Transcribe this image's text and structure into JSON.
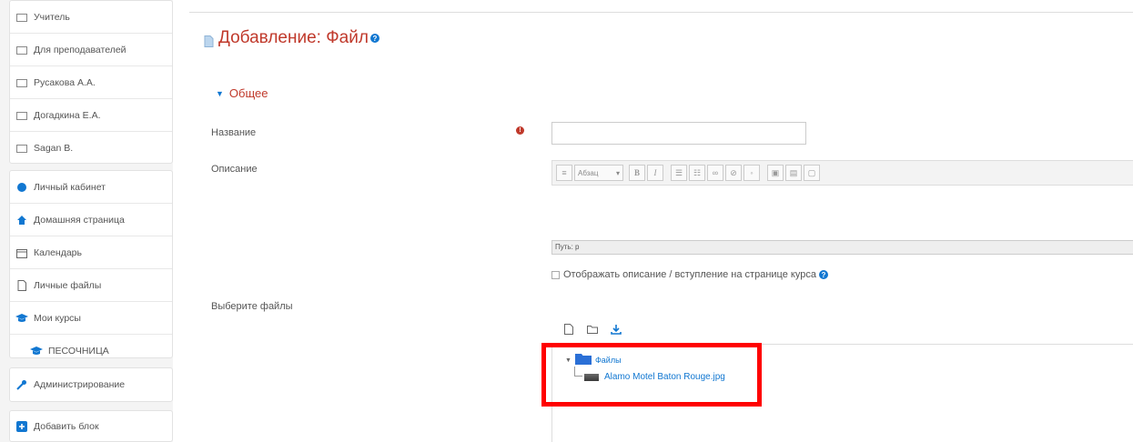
{
  "sidebar": {
    "courses": [
      {
        "label": "Учитель"
      },
      {
        "label": "Для преподавателей"
      },
      {
        "label": "Русакова А.А."
      },
      {
        "label": "Догадкина Е.А."
      },
      {
        "label": "Sagan B."
      }
    ],
    "nav": {
      "profile": "Личный кабинет",
      "home": "Домашняя страница",
      "calendar": "Календарь",
      "files": "Личные файлы",
      "mycourses": "Мои курсы",
      "course": "ПЕСОЧНИЦА"
    },
    "admin": "Администрирование",
    "add_block": "Добавить блок"
  },
  "page": {
    "title": "Добавление: Файл",
    "section": "Общее",
    "name_label": "Название",
    "name_value": "",
    "description_label": "Описание",
    "editor_style_value": "Абзац",
    "editor_path": "Путь: p",
    "show_description": "Отображать описание / вступление на странице курса",
    "select_files_label": "Выберите файлы",
    "folder_label": "Файлы",
    "file_name": "Alamo Motel Baton Rouge.jpg"
  },
  "colors": {
    "title": "#c0392b",
    "link": "#1177d1",
    "highlight": "#ff0000"
  }
}
